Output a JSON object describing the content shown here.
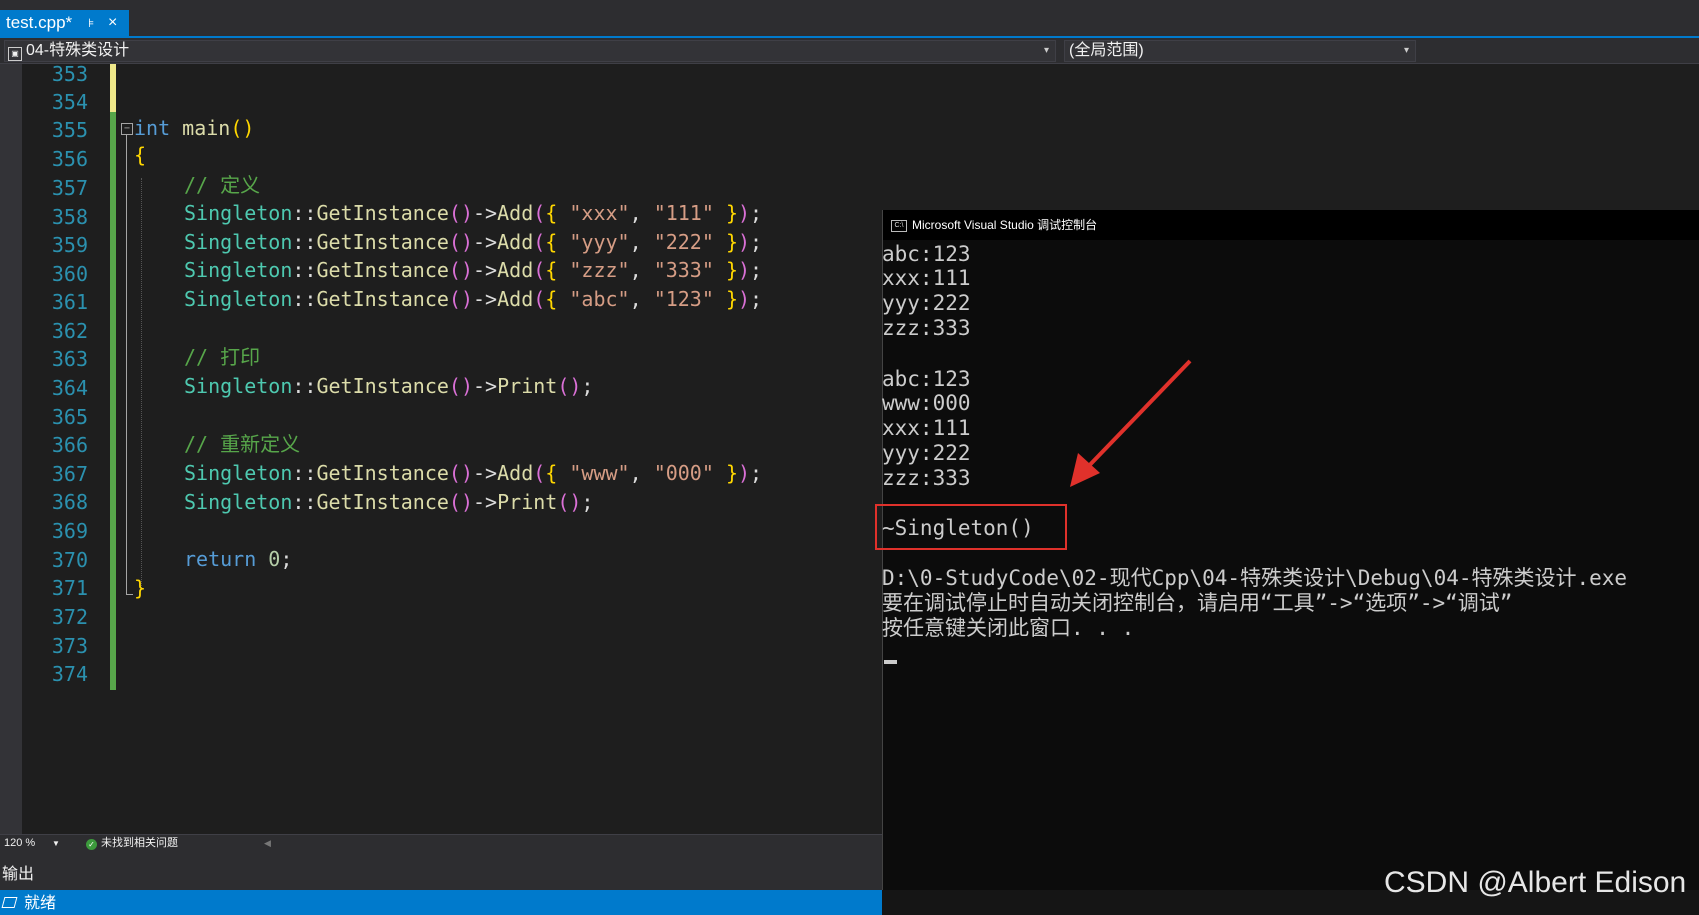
{
  "tab": {
    "filename": "test.cpp*",
    "pin_glyph": "⊧",
    "close_glyph": "×"
  },
  "navbar": {
    "project": "04-特殊类设计",
    "scope": "(全局范围)",
    "dropdown_glyph": "▾"
  },
  "editor": {
    "zoom": "120 %",
    "issues_text": "未找到相关问题",
    "line_numbers": [
      "353",
      "354",
      "355",
      "356",
      "357",
      "358",
      "359",
      "360",
      "361",
      "362",
      "363",
      "364",
      "365",
      "366",
      "367",
      "368",
      "369",
      "370",
      "371",
      "372",
      "373",
      "374"
    ]
  },
  "code": {
    "int_kw": "int",
    "main_fn": "main",
    "paren_open": "(",
    "paren_close": ")",
    "brace_open": "{",
    "brace_close": "}",
    "comment_define": "// 定义",
    "comment_print": "// 打印",
    "comment_redefine": "// 重新定义",
    "class_name": "Singleton",
    "scope_op": "::",
    "get_instance": "GetInstance",
    "arrow_op": "->",
    "add_fn": "Add",
    "print_fn": "Print",
    "comma": ",",
    "semicolon": ";",
    "add_calls": [
      {
        "key": "\"xxx\"",
        "value": "\"111\""
      },
      {
        "key": "\"yyy\"",
        "value": "\"222\""
      },
      {
        "key": "\"zzz\"",
        "value": "\"333\""
      },
      {
        "key": "\"abc\"",
        "value": "\"123\""
      },
      {
        "key": "\"www\"",
        "value": "\"000\""
      }
    ],
    "return_kw": "return",
    "return_value": "0"
  },
  "console": {
    "title": "Microsoft Visual Studio 调试控制台",
    "icon_text": "C:\\",
    "lines": [
      "abc:123",
      "xxx:111",
      "yyy:222",
      "zzz:333",
      "abc:123",
      "www:000",
      "xxx:111",
      "yyy:222",
      "zzz:333",
      "~Singleton()",
      "D:\\0-StudyCode\\02-现代Cpp\\04-特殊类设计\\Debug\\04-特殊类设计.exe",
      "要在调试停止时自动关闭控制台，请启用“工具”->“选项”->“调试”",
      "按任意键关闭此窗口. . ."
    ]
  },
  "output_panel": {
    "title": "输出"
  },
  "status": {
    "text": "就绪"
  },
  "watermark": "CSDN @Albert Edison",
  "colors": {
    "accent": "#007acc",
    "annotation_red": "#e0312b",
    "change_saved": "#57a64a",
    "change_unsaved": "#efe88a"
  }
}
